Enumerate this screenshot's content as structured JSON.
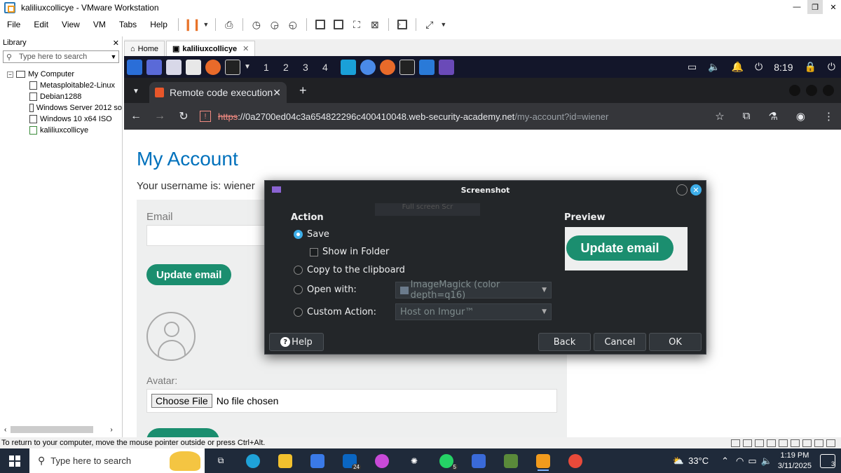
{
  "vmware": {
    "title": "kaliliuxcollicye - VMware Workstation",
    "menu": [
      "File",
      "Edit",
      "View",
      "VM",
      "Tabs",
      "Help"
    ],
    "library": {
      "title": "Library",
      "search_placeholder": "Type here to search",
      "root": "My Computer",
      "vms": [
        "Metasploitable2-Linux",
        "Debian1288",
        "Windows Server 2012 so",
        "Windows 10 x64 ISO",
        "kaliliuxcollicye"
      ]
    },
    "tabs": [
      "Home",
      "kaliliuxcollicye"
    ],
    "status_hint": "To return to your computer, move the mouse pointer outside or press Ctrl+Alt."
  },
  "kali_panel": {
    "workspaces": [
      "1",
      "2",
      "3",
      "4"
    ],
    "clock": "8:19"
  },
  "chrome": {
    "tab_title": "Remote code execution v",
    "url_scheme": "https",
    "url_host": "://0a2700ed04c3a654822296c400410048.web-security-academy.net",
    "url_path": "/my-account?id=wiener"
  },
  "page": {
    "heading": "My Account",
    "username_text": "Your username is: wiener",
    "email_label": "Email",
    "update_button": "Update email",
    "avatar_label": "Avatar:",
    "choose_file": "Choose File",
    "no_file": "No file chosen"
  },
  "dialog": {
    "title": "Screenshot",
    "ghost_text": "Full screen Scr",
    "action_heading": "Action",
    "preview_heading": "Preview",
    "options": {
      "save": "Save",
      "show_in_folder": "Show in Folder",
      "copy": "Copy to the clipboard",
      "open_with": "Open with:",
      "custom": "Custom Action:"
    },
    "open_with_value": "ImageMagick (color depth=q16)",
    "custom_value": "Host on Imgur™",
    "preview_button": "Update email",
    "buttons": {
      "help": "Help",
      "back": "Back",
      "cancel": "Cancel",
      "ok": "OK"
    }
  },
  "taskbar": {
    "search_placeholder": "Type here to search",
    "temperature": "33°C",
    "time": "1:19 PM",
    "date": "3/11/2025",
    "notif_count": "3",
    "badge_in": "24",
    "badge_wa": "5"
  }
}
